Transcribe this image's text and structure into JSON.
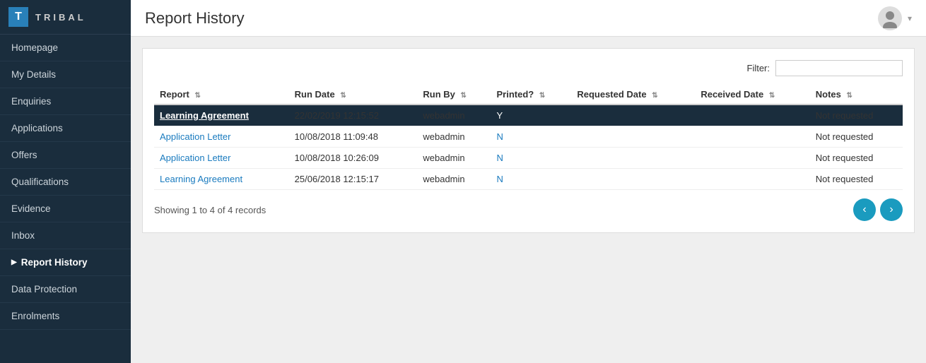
{
  "app": {
    "logo_letter": "T",
    "logo_text": "TRIBAL"
  },
  "sidebar": {
    "items": [
      {
        "id": "homepage",
        "label": "Homepage",
        "active": false,
        "arrow": false
      },
      {
        "id": "my-details",
        "label": "My Details",
        "active": false,
        "arrow": false
      },
      {
        "id": "enquiries",
        "label": "Enquiries",
        "active": false,
        "arrow": false
      },
      {
        "id": "applications",
        "label": "Applications",
        "active": false,
        "arrow": false
      },
      {
        "id": "offers",
        "label": "Offers",
        "active": false,
        "arrow": false
      },
      {
        "id": "qualifications",
        "label": "Qualifications",
        "active": false,
        "arrow": false
      },
      {
        "id": "evidence",
        "label": "Evidence",
        "active": false,
        "arrow": false
      },
      {
        "id": "inbox",
        "label": "Inbox",
        "active": false,
        "arrow": false
      },
      {
        "id": "report-history",
        "label": "Report History",
        "active": true,
        "arrow": true
      },
      {
        "id": "data-protection",
        "label": "Data Protection",
        "active": false,
        "arrow": false
      },
      {
        "id": "enrolments",
        "label": "Enrolments",
        "active": false,
        "arrow": false
      }
    ]
  },
  "header": {
    "title": "Report History"
  },
  "filter": {
    "label": "Filter:",
    "placeholder": "",
    "value": ""
  },
  "table": {
    "columns": [
      {
        "id": "report",
        "label": "Report"
      },
      {
        "id": "run-date",
        "label": "Run Date"
      },
      {
        "id": "run-by",
        "label": "Run By"
      },
      {
        "id": "printed",
        "label": "Printed?"
      },
      {
        "id": "requested-date",
        "label": "Requested Date"
      },
      {
        "id": "received-date",
        "label": "Received Date"
      },
      {
        "id": "notes",
        "label": "Notes"
      }
    ],
    "rows": [
      {
        "report": "Learning Agreement",
        "run_date": "22/02/2019 12:15:52",
        "run_by": "webadmin",
        "printed": "Y",
        "requested_date": "",
        "received_date": "",
        "notes": "Not requested",
        "selected": true,
        "link": true
      },
      {
        "report": "Application Letter",
        "run_date": "10/08/2018 11:09:48",
        "run_by": "webadmin",
        "printed": "N",
        "requested_date": "",
        "received_date": "",
        "notes": "Not requested",
        "selected": false,
        "link": true
      },
      {
        "report": "Application Letter",
        "run_date": "10/08/2018 10:26:09",
        "run_by": "webadmin",
        "printed": "N",
        "requested_date": "",
        "received_date": "",
        "notes": "Not requested",
        "selected": false,
        "link": true
      },
      {
        "report": "Learning Agreement",
        "run_date": "25/06/2018 12:15:17",
        "run_by": "webadmin",
        "printed": "N",
        "requested_date": "",
        "received_date": "",
        "notes": "Not requested",
        "selected": false,
        "link": true
      }
    ]
  },
  "pagination": {
    "info": "Showing 1 to 4 of 4 records",
    "prev_label": "‹",
    "next_label": "›"
  }
}
